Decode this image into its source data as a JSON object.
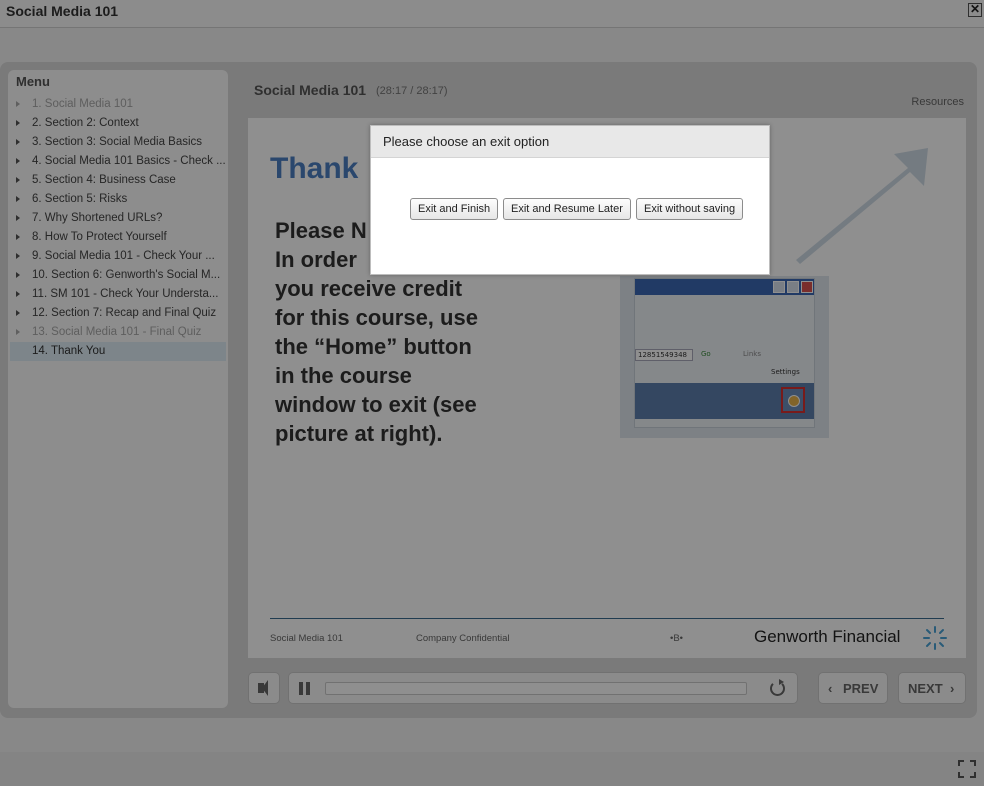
{
  "window": {
    "title": "Social Media 101",
    "close_glyph": "✕"
  },
  "menu": {
    "title": "Menu",
    "items": [
      {
        "label": "1. Social Media 101",
        "state": "visited"
      },
      {
        "label": "2. Section 2: Context",
        "state": "normal"
      },
      {
        "label": "3. Section 3: Social Media Basics",
        "state": "normal"
      },
      {
        "label": "4. Social Media 101 Basics - Check ...",
        "state": "normal"
      },
      {
        "label": "5. Section 4: Business Case",
        "state": "normal"
      },
      {
        "label": "6. Section 5: Risks",
        "state": "normal"
      },
      {
        "label": "7. Why Shortened URLs?",
        "state": "normal"
      },
      {
        "label": "8. How To Protect Yourself",
        "state": "normal"
      },
      {
        "label": "9. Social Media 101 - Check Your ...",
        "state": "normal"
      },
      {
        "label": "10. Section 6: Genworth's Social M...",
        "state": "normal"
      },
      {
        "label": "11. SM 101 - Check Your Understa...",
        "state": "normal"
      },
      {
        "label": "12. Section 7: Recap and Final Quiz",
        "state": "normal"
      },
      {
        "label": "13. Social Media 101 - Final Quiz",
        "state": "visited"
      },
      {
        "label": "14. Thank You",
        "state": "active"
      }
    ]
  },
  "header": {
    "course_title": "Social Media 101",
    "time": "(28:17 / 28:17)",
    "resources": "Resources"
  },
  "slide": {
    "heading": "Thank",
    "body_lines": [
      "Please N",
      "In order",
      "you receive credit",
      "for this course, use",
      "the “Home” button",
      "in the course",
      "window to exit (see",
      "picture at right)."
    ],
    "screenshot": {
      "address_text": "12851549348",
      "go_label": "Go",
      "links_label": "Links",
      "settings_label": "Settings"
    },
    "footer": {
      "course": "Social Media 101",
      "confidential": "Company Confidential",
      "page_mark": "•B•",
      "brand": "Genworth Financial"
    }
  },
  "controls": {
    "prev_label": "PREV",
    "next_label": "NEXT",
    "prev_chevron": "‹",
    "next_chevron": "›",
    "progress": 0.0
  },
  "dialog": {
    "title": "Please choose an exit option",
    "buttons": [
      "Exit and Finish",
      "Exit and Resume Later",
      "Exit without saving"
    ]
  }
}
